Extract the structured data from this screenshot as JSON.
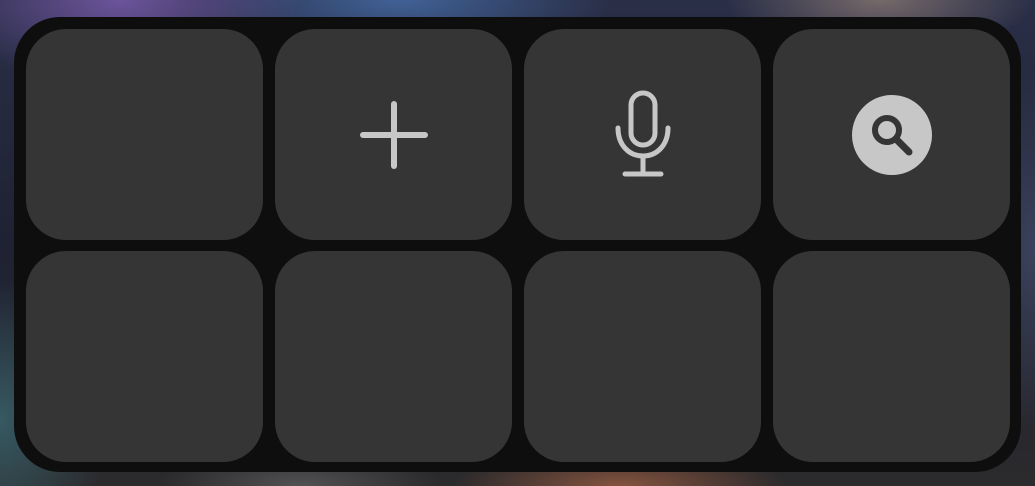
{
  "panel": {
    "tiles": [
      {
        "name": "empty-slot-1",
        "icon": ""
      },
      {
        "name": "add-button",
        "icon": "plus-icon"
      },
      {
        "name": "microphone-button",
        "icon": "microphone-icon"
      },
      {
        "name": "search-button",
        "icon": "magnifier-circle-icon"
      },
      {
        "name": "empty-slot-2",
        "icon": ""
      },
      {
        "name": "empty-slot-3",
        "icon": ""
      },
      {
        "name": "empty-slot-4",
        "icon": ""
      },
      {
        "name": "empty-slot-5",
        "icon": ""
      }
    ]
  },
  "colors": {
    "panel_background": "#0e0e0e",
    "tile_background": "#353535",
    "icon_color": "#c7c7c7"
  }
}
